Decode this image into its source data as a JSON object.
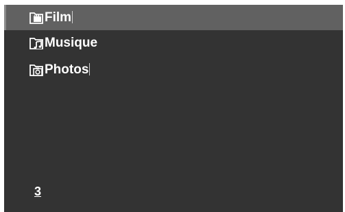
{
  "folders": [
    {
      "label": "Film",
      "icon": "folder-film-icon",
      "selected": true
    },
    {
      "label": "Musique",
      "icon": "folder-music-icon",
      "selected": false
    },
    {
      "label": "Photos",
      "icon": "folder-photo-icon",
      "selected": false
    }
  ],
  "footer": {
    "count": "3"
  },
  "colors": {
    "panel_bg": "#333333",
    "selected_bg": "#616161",
    "text": "#ffffff"
  }
}
